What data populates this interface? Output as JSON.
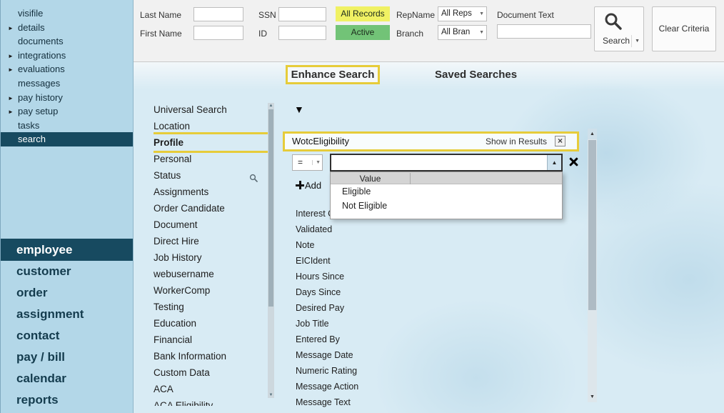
{
  "colors": {
    "sidebar_bg": "#b3d7e8",
    "selected_navy": "#174a60",
    "highlight_gold": "#e6cc3a",
    "all_records_yellow": "#f0f163",
    "active_green": "#72c377",
    "main_bg": "#d8ebf4"
  },
  "sidebar": {
    "top_items": [
      {
        "label": "visifile"
      },
      {
        "label": "details"
      },
      {
        "label": "documents"
      },
      {
        "label": "integrations"
      },
      {
        "label": "evaluations"
      },
      {
        "label": "messages"
      },
      {
        "label": "pay history"
      },
      {
        "label": "pay setup"
      },
      {
        "label": "tasks"
      },
      {
        "label": "search",
        "selected": true
      }
    ],
    "bottom_items": [
      {
        "label": "employee",
        "selected": true
      },
      {
        "label": "customer"
      },
      {
        "label": "order"
      },
      {
        "label": "assignment"
      },
      {
        "label": "contact"
      },
      {
        "label": "pay / bill"
      },
      {
        "label": "calendar"
      },
      {
        "label": "reports"
      }
    ]
  },
  "search_form": {
    "last_name_label": "Last Name",
    "first_name_label": "First Name",
    "ssn_label": "SSN",
    "id_label": "ID",
    "last_name_value": "",
    "first_name_value": "",
    "ssn_value": "",
    "id_value": "",
    "all_records_button": "All Records",
    "active_button": "Active",
    "repname_label": "RepName",
    "repname_value": "All Reps",
    "branch_label": "Branch",
    "branch_value": "All Bran",
    "document_text_label": "Document Text",
    "document_text_value": "",
    "search_button": "Search",
    "clear_button": "Clear Criteria"
  },
  "tabs": [
    {
      "label": "Enhance Search",
      "highlighted": true
    },
    {
      "label": "Saved Searches",
      "highlighted": false
    }
  ],
  "category_list": [
    "Universal Search",
    "Location",
    "Profile",
    "Personal",
    "Status",
    "Assignments",
    "Order Candidate",
    "Document",
    "Direct Hire",
    "Job History",
    "webusername",
    "WorkerComp",
    "Testing",
    "Education",
    "Financial",
    "Bank Information",
    "Custom Data",
    "ACA",
    "ACA Eligibility"
  ],
  "selected_category": "Profile",
  "filter_builder": {
    "field_name": "WotcEligibility",
    "show_in_results_label": "Show in Results",
    "operator_value": "=",
    "value_input": "",
    "add_button": "Add",
    "value_dropdown": {
      "header": "Value",
      "options": [
        "Eligible",
        "Not Eligible"
      ]
    },
    "available_fields": [
      "Interest Codes",
      "Validated",
      "Note",
      "EICIdent",
      "Hours Since",
      "Days Since",
      "Desired Pay",
      "Job Title",
      "Entered By",
      "Message Date",
      "Numeric Rating",
      "Message Action",
      "Message Text"
    ]
  },
  "icons": {
    "expand_arrow": "►",
    "filter_triangle": "▼",
    "dropdown_arrow": "▼",
    "combo_up_arrow": "▲",
    "scroll_up": "▲",
    "scroll_down": "▼",
    "checkbox_mark": "×"
  }
}
